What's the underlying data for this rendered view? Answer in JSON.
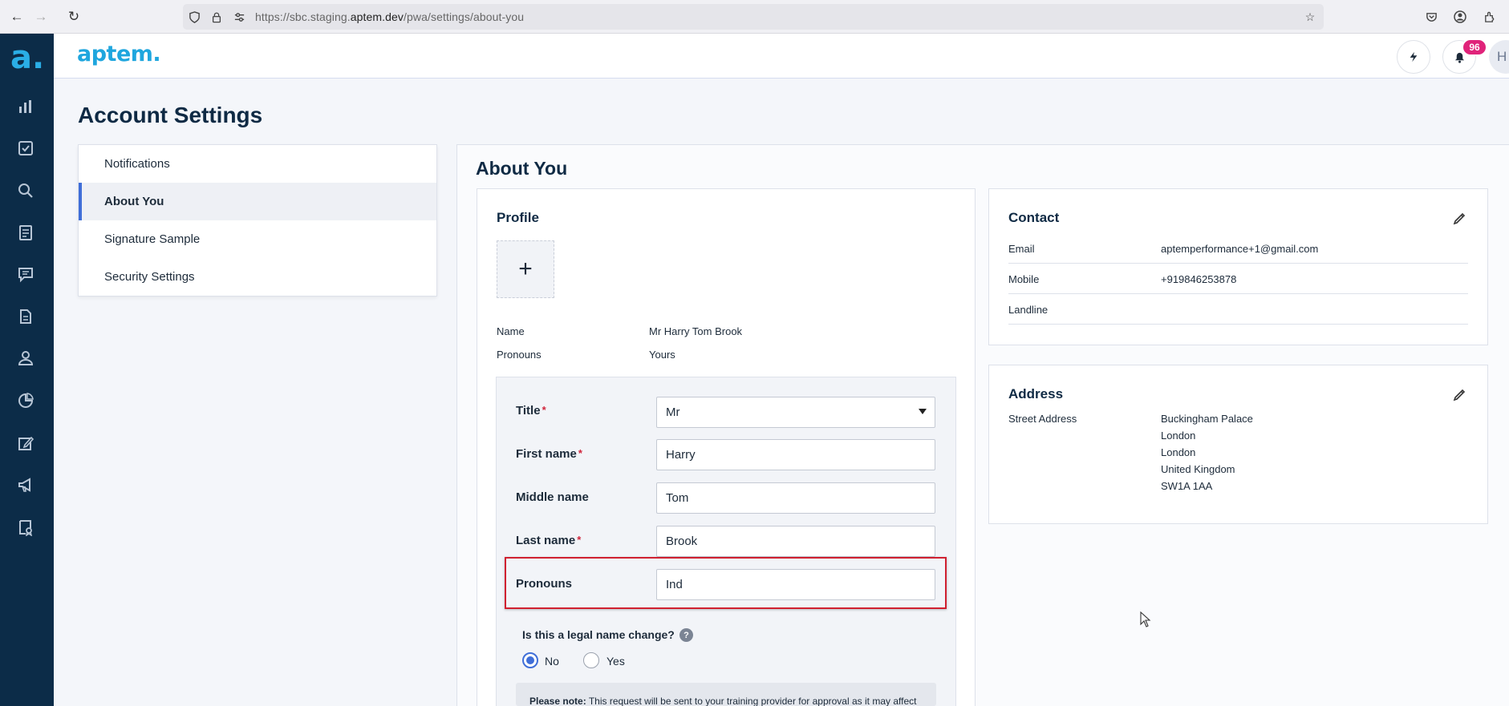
{
  "browser": {
    "url_prefix": "https://sbc.staging.",
    "url_domain": "aptem.dev",
    "url_path": "/pwa/settings/about-you"
  },
  "header": {
    "brand": "aptem.",
    "notification_count": "96",
    "avatar_initials": "HE"
  },
  "page": {
    "title": "Account Settings"
  },
  "side_menu": {
    "items": [
      {
        "label": "Notifications",
        "active": false
      },
      {
        "label": "About You",
        "active": true
      },
      {
        "label": "Signature Sample",
        "active": false
      },
      {
        "label": "Security Settings",
        "active": false
      }
    ]
  },
  "about_you": {
    "title": "About You",
    "profile": {
      "title": "Profile",
      "name_label": "Name",
      "name_value": "Mr Harry Tom Brook",
      "pronouns_label": "Pronouns",
      "pronouns_value": "Yours"
    },
    "form": {
      "title_label": "Title",
      "title_value": "Mr",
      "first_name_label": "First name",
      "first_name_value": "Harry",
      "middle_name_label": "Middle name",
      "middle_name_value": "Tom",
      "last_name_label": "Last name",
      "last_name_value": "Brook",
      "pronouns_label": "Pronouns",
      "pronouns_value": "Ind",
      "required_mark": "*",
      "legal_question": "Is this a legal name change?",
      "help_mark": "?",
      "option_no": "No",
      "option_yes": "Yes",
      "selected_option": "No",
      "note_bold": "Please note:",
      "note_text": " This request will be sent to your training provider for approval as it may affect"
    },
    "contact": {
      "title": "Contact",
      "email_label": "Email",
      "email_value": "aptemperformance+1@gmail.com",
      "mobile_label": "Mobile",
      "mobile_value": "+919846253878",
      "landline_label": "Landline",
      "landline_value": ""
    },
    "address": {
      "title": "Address",
      "street_label": "Street Address",
      "lines": [
        "Buckingham Palace",
        "London",
        "London",
        "United Kingdom",
        "SW1A 1AA"
      ]
    }
  },
  "colors": {
    "rail": "#0c2c48",
    "brand": "#1fa6de",
    "accent": "#3f6ed8",
    "badge": "#e0237a",
    "highlight": "#d02030"
  },
  "icons": {
    "rail": [
      "logo-icon",
      "chart-icon",
      "checkbox-icon",
      "search-icon",
      "clipboard-icon",
      "chat-icon",
      "document-icon",
      "person-icon",
      "pie-chart-icon",
      "edit-icon",
      "megaphone-icon",
      "certificate-icon"
    ]
  }
}
